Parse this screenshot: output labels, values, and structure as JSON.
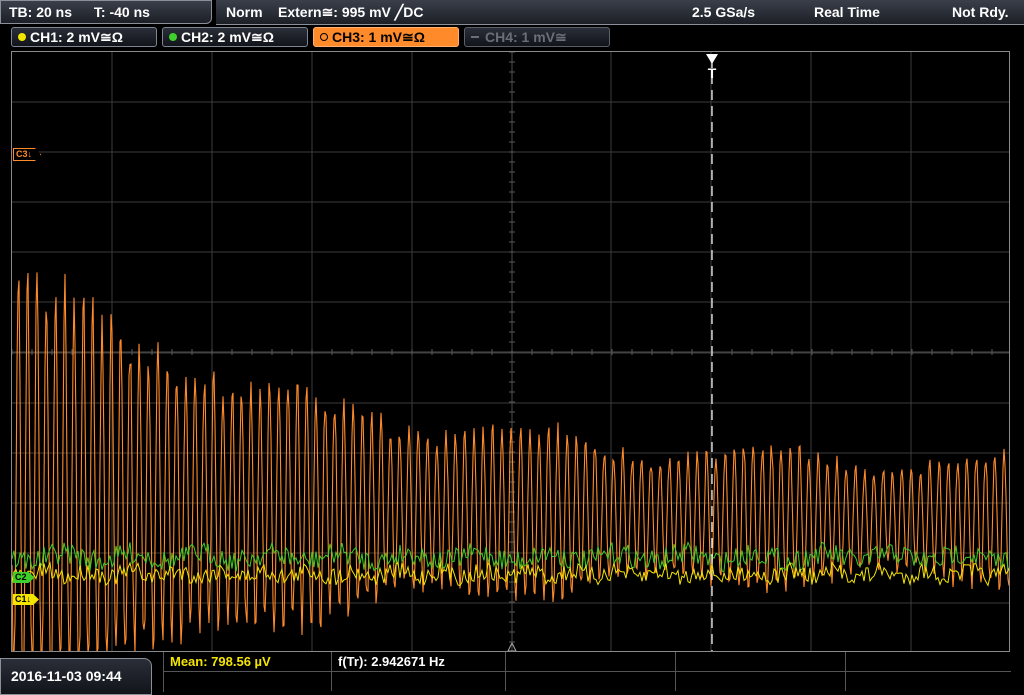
{
  "timebase": {
    "tb": "TB: 20 ns",
    "trigger_time": "T: -40 ns"
  },
  "status": {
    "mode": "Norm",
    "trigger_source": "Extern≅: 995 mV ╱DC",
    "sample_rate": "2.5 GSa/s",
    "acq_mode": "Real Time",
    "state": "Not Rdy."
  },
  "channels": [
    {
      "label": "CH1: 2 mV≅Ω",
      "color": "#f4e500",
      "state": "on"
    },
    {
      "label": "CH2: 2 mV≅Ω",
      "color": "#3ecf2a",
      "state": "on"
    },
    {
      "label": "CH3: 1 mV≅Ω",
      "color": "#ff8a2a",
      "state": "active"
    },
    {
      "label": "CH4: 1 mV≅",
      "color": "#6a6e76",
      "state": "off"
    }
  ],
  "markers": {
    "c3": "C3↓",
    "c2": "C2",
    "c1": "C1↓",
    "trigger": "T"
  },
  "date": "2016-11-03 09:44",
  "measurements": {
    "mean": "Mean: 798.56 µV",
    "freq": "f(Tr): 2.942671 Hz"
  },
  "colors": {
    "ch1": "#f4e500",
    "ch2": "#3ecf2a",
    "ch3": "#ff8a2a",
    "grid": "#3c3c3c",
    "measure_label": "#f4e500"
  }
}
